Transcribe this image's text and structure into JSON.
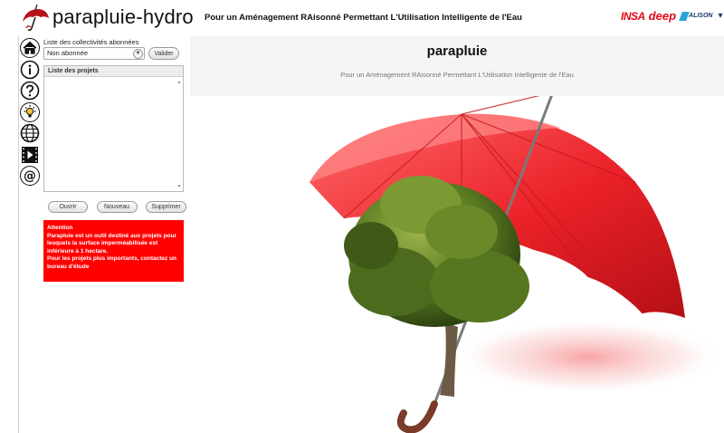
{
  "header": {
    "app_name": "parapluie-hydro",
    "tagline": "Pour un Aménagement RAisonné Permettant L'Utilisation Intelligente de l'Eau",
    "partners": [
      "INSA",
      "deep",
      "ALISON"
    ]
  },
  "sidebar_icons": [
    "home-icon",
    "info-icon",
    "help-icon",
    "idea-icon",
    "globe-icon",
    "video-icon",
    "contact-icon"
  ],
  "panel": {
    "subscribed_label": "Liste des collectivités abonnées",
    "select_value": "Non abonnée",
    "validate_label": "Valider",
    "projects_header": "Liste des projets",
    "open_label": "Ouvrir",
    "new_label": "Nouveau",
    "delete_label": "Supprimer"
  },
  "alert": {
    "title": "Attention",
    "line1": "Parapluie est un outil destiné aux projets pour lesquels la surface imperméabilisée est inférieure à 1 hectare.",
    "line2": "Pour les projets plus importants, contactez un bureau d'étude"
  },
  "main": {
    "title": "parapluie",
    "subtitle": "Pour un Aménagement RAisonné Permettant L'Utilisation Intelligente de l'Eau"
  },
  "colors": {
    "alert_bg": "#ff0000",
    "umbrella": "#e8222a",
    "brand_red": "#e30613"
  }
}
